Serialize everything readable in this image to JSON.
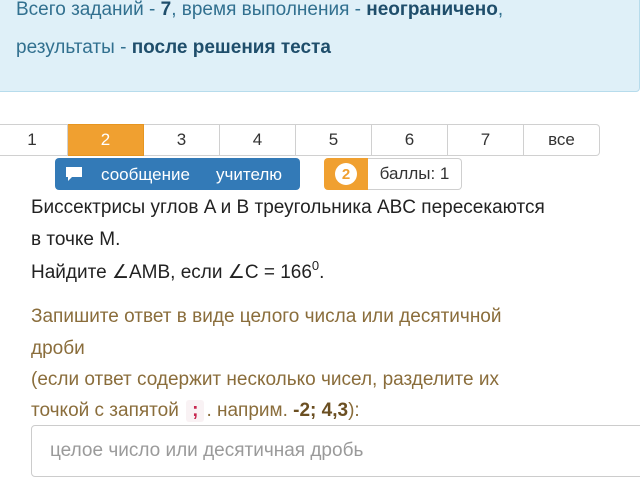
{
  "info": {
    "line1_prefix": "Всего заданий - ",
    "total_tasks": "7",
    "line1_mid": ", время выполнения - ",
    "time_limit": "неограничено",
    "line1_suffix": ",",
    "line2_prefix": "результаты - ",
    "results_when": "после решения теста"
  },
  "pager": {
    "items": [
      "1",
      "2",
      "3",
      "4",
      "5",
      "6",
      "7",
      "все"
    ],
    "active_index": 1
  },
  "message_button": {
    "word1": "сообщение",
    "word2": "учителю"
  },
  "score": {
    "value": "2",
    "label": "баллы: 1"
  },
  "task": {
    "line1": "Биссектрисы углов A и B треугольника ABC пересекаются",
    "line2": "в точке M.",
    "line3_prefix": "Найдите ",
    "angle_symbol": "∠",
    "angle_target": "AMB",
    "line3_mid": ", если ",
    "angle_given": "C = 166",
    "degree_sup": "0",
    "line3_suffix": "."
  },
  "hint": {
    "line1": "Запишите ответ в виде целого числа или десятичной",
    "line2": "дроби",
    "line3": "(если ответ содержит несколько чисел, разделите их",
    "line4_prefix": "точкой с запятой",
    "separator": ";",
    "line4_mid": ". наприм. ",
    "example": "-2; 4,3",
    "line4_suffix": "):"
  },
  "answer": {
    "placeholder": "целое число или десятичная дробь",
    "value": ""
  },
  "colors": {
    "accent": "#f0a030",
    "primary": "#337ab7",
    "info_bg": "#dff0f8",
    "hint_text": "#8a6d3b"
  }
}
